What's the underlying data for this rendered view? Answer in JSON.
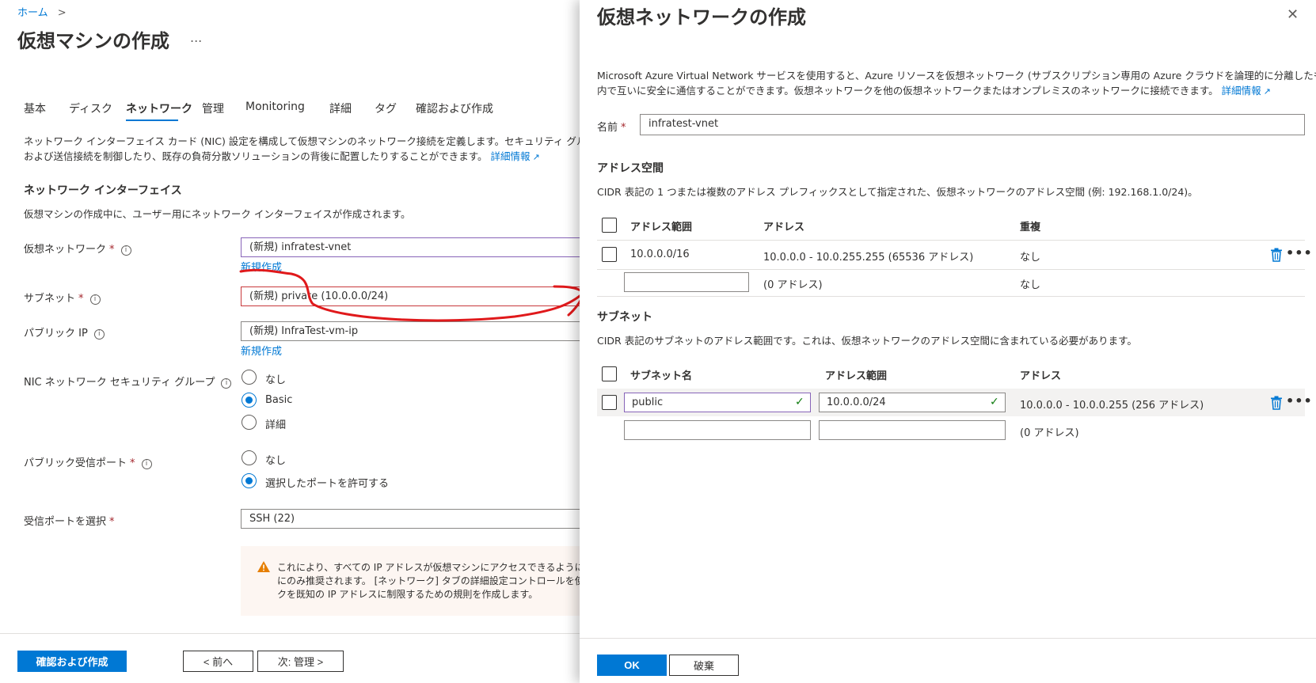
{
  "left": {
    "breadcrumb": "ホーム",
    "breadcrumb_sep": ">",
    "title": "仮想マシンの作成",
    "title_more": "...",
    "tabs": [
      {
        "label": "基本"
      },
      {
        "label": "ディスク"
      },
      {
        "label": "ネットワーク"
      },
      {
        "label": "管理"
      },
      {
        "label": "Monitoring"
      },
      {
        "label": "詳細"
      },
      {
        "label": "タグ"
      },
      {
        "label": "確認および作成"
      }
    ],
    "description_line1": "ネットワーク インターフェイス カード (NIC) 設定を構成して仮想マシンのネットワーク接続を定義します。セキュリティ グループの規則",
    "description_line2": "および送信接続を制御したり、既存の負荷分散ソリューションの背後に配置したりすることができます。",
    "learn_more": "詳細情報",
    "section_title": "ネットワーク インターフェイス",
    "section_desc": "仮想マシンの作成中に、ユーザー用にネットワーク インターフェイスが作成されます。",
    "vnet_label": "仮想ネットワーク",
    "vnet_value": "(新規) infratest-vnet",
    "vnet_create": "新規作成",
    "subnet_label": "サブネット",
    "subnet_value": "(新規) private (10.0.0.0/24)",
    "pip_label": "パブリック IP",
    "pip_value": "(新規) InfraTest-vm-ip",
    "pip_create": "新規作成",
    "nsg_label": "NIC ネットワーク セキュリティ グループ",
    "nsg_options": [
      "なし",
      "Basic",
      "詳細"
    ],
    "ports_label": "パブリック受信ポート",
    "ports_options": [
      "なし",
      "選択したポートを許可する"
    ],
    "inbound_label": "受信ポートを選択",
    "inbound_value": "SSH (22)",
    "warning_line1": "これにより、すべての IP アドレスが仮想マシンにアクセスできるようになります",
    "warning_line2": "にのみ推奨されます。 [ネットワーク] タブの詳細設定コントロールを使用して",
    "warning_line3": "クを既知の IP アドレスに制限するための規則を作成します。",
    "btn_review": "確認および作成",
    "btn_prev": "< 前へ",
    "btn_next": "次: 管理 >",
    "required_mark": "*",
    "info_glyph": "i"
  },
  "panel": {
    "title": "仮想ネットワークの作成",
    "close": "✕",
    "intro_line1": "Microsoft Azure Virtual Network サービスを使用すると、Azure リソースを仮想ネットワーク (サブスクリプション専用の Azure クラウドを論理的に分離したもの)",
    "intro_line2": "内で互いに安全に通信することができます。仮想ネットワークを他の仮想ネットワークまたはオンプレミスのネットワークに接続できます。",
    "learn_more": "詳細情報",
    "name_label": "名前",
    "name_value": "infratest-vnet",
    "address_space_title": "アドレス空間",
    "address_space_desc": "CIDR 表記の 1 つまたは複数のアドレス プレフィックスとして指定された、仮想ネットワークのアドレス空間 (例: 192.168.1.0/24)。",
    "address_headers": [
      "アドレス範囲",
      "アドレス",
      "重複"
    ],
    "address_rows": [
      {
        "range": "10.0.0.0/16",
        "addresses": "10.0.0.0 - 10.0.255.255 (65536 アドレス)",
        "overlap": "なし"
      },
      {
        "range": "",
        "addresses": "(0 アドレス)",
        "overlap": "なし"
      }
    ],
    "subnet_title": "サブネット",
    "subnet_desc": "CIDR 表記のサブネットのアドレス範囲です。これは、仮想ネットワークのアドレス空間に含まれている必要があります。",
    "subnet_headers": [
      "サブネット名",
      "アドレス範囲",
      "アドレス"
    ],
    "subnet_rows": [
      {
        "name": "public",
        "range": "10.0.0.0/24",
        "addresses": "10.0.0.0 - 10.0.0.255 (256 アドレス)"
      },
      {
        "name": "",
        "range": "",
        "addresses": "(0 アドレス)"
      }
    ],
    "btn_ok": "OK",
    "btn_discard": "破棄",
    "more_glyph": "•••",
    "check_glyph": "✓"
  },
  "colors": {
    "accent": "#0078d4",
    "annotation": "#e0191b",
    "warning_bg": "#fdf6f2",
    "warning_icon": "#e67e00"
  }
}
